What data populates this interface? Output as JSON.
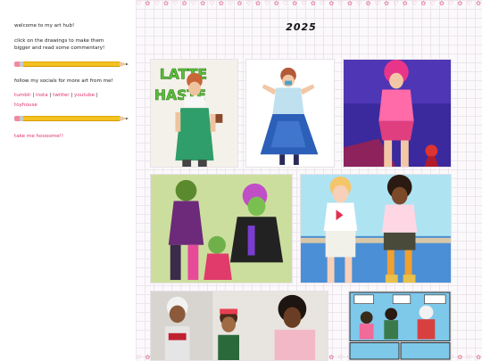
{
  "sidebar": {
    "welcome": "welcome to my art hub!",
    "intro_line1": "click on the drawings to make them",
    "intro_line2": "bigger and read some commentary!",
    "follow": "follow my socials for more art from me!",
    "links": {
      "tumblr": "tumblr",
      "insta": "insta",
      "twitter": "twitter",
      "youtube": "youtube",
      "toyhouse": "toyhouse",
      "sep": " | "
    },
    "home_link": "take me hoooome!!"
  },
  "header": {
    "year": "2025"
  },
  "decor": {
    "border_pattern": "♡ ✿ ♡ ✿ ♡ ✿ ♡ ✿ ♡ ✿ ♡ ✿ ♡ ✿ ♡ ✿ ♡ ✿ ♡ ✿ ♡ ✿ ♡ ✿ ♡ ✿ ♡ ✿ ♡ ✿ ♡ ✿ ♡ ✿ ♡ ✿ ♡ ✿ ♡ ✿ ♡ ✿ ♡ ✿ ♡ ✿"
  },
  "artworks": [
    {
      "id": "latte-haste",
      "sign_text_1": "LATTE",
      "sign_text_2": "HASTE"
    },
    {
      "id": "blue-dress"
    },
    {
      "id": "pink-outfit"
    },
    {
      "id": "green-characters"
    },
    {
      "id": "two-friends-sitting"
    },
    {
      "id": "group-scene"
    },
    {
      "id": "comic-page"
    }
  ],
  "colors": {
    "accent": "#e0306a",
    "pencil_yellow": "#f3c221",
    "grid_line": "#ece6ec",
    "border_pink": "#e58aa4"
  }
}
